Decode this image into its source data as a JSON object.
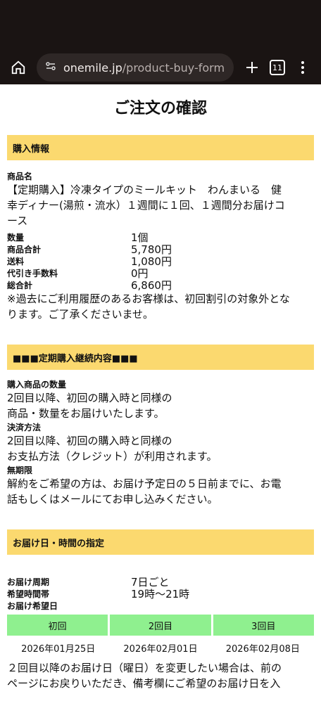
{
  "browser": {
    "url_host": "onemile.jp",
    "url_path": "/product-buy-form",
    "tab_count": "11"
  },
  "page_title": "ご注文の確認",
  "purchase": {
    "heading": "購入情報",
    "product_label": "商品名",
    "product_name_line1": "【定期購入】冷凍タイプのミールキット　わんまいる　健",
    "product_name_line2": "幸ディナー(湯煎・流水）１週間に１回、１週間分お届けコ",
    "product_name_line3": "ース",
    "rows": [
      {
        "key": "数量",
        "value": "1個"
      },
      {
        "key": "商品合計",
        "value": "5,780円"
      },
      {
        "key": "送料",
        "value": "1,080円"
      },
      {
        "key": "代引き手数料",
        "value": "0円"
      },
      {
        "key": "総合計",
        "value": "6,860円"
      }
    ],
    "note_line1": "※過去にご利用履歴のあるお客様は、初回割引の対象外とな",
    "note_line2": "ります。ご了承くださいませ。"
  },
  "subscription": {
    "heading": "■■■定期購入継続内容■■■",
    "qty_label": "購入商品の数量",
    "qty_line1": "2回目以降、初回の購入時と同様の",
    "qty_line2": "商品・数量をお届けいたします。",
    "pay_label": "決済方法",
    "pay_line1": "2回目以降、初回の購入時と同様の",
    "pay_line2": "お支払方法（クレジット）が利用されます。",
    "period_label": "無期限",
    "period_line1": "解約をご希望の方は、お届け予定日の５日前までに、お電",
    "period_line2": "話もしくはメールにてお申し込みください。"
  },
  "delivery": {
    "heading": "お届け日・時間の指定",
    "cycle_label": "お届け周期",
    "cycle_value": "7日ごと",
    "time_label": "希望時間帯",
    "time_value": "19時〜21時",
    "date_label": "お届け希望日",
    "schedule_headers": [
      "初回",
      "2回目",
      "3回目"
    ],
    "schedule_dates": [
      "2026年01月25日",
      "2026年02月01日",
      "2026年02月08日"
    ],
    "change_line1": "２回目以降のお届け日（曜日）を変更したい場合は、前の",
    "change_line2": "ページにお戻りいただき、備考欄にご希望のお届け日を入"
  }
}
